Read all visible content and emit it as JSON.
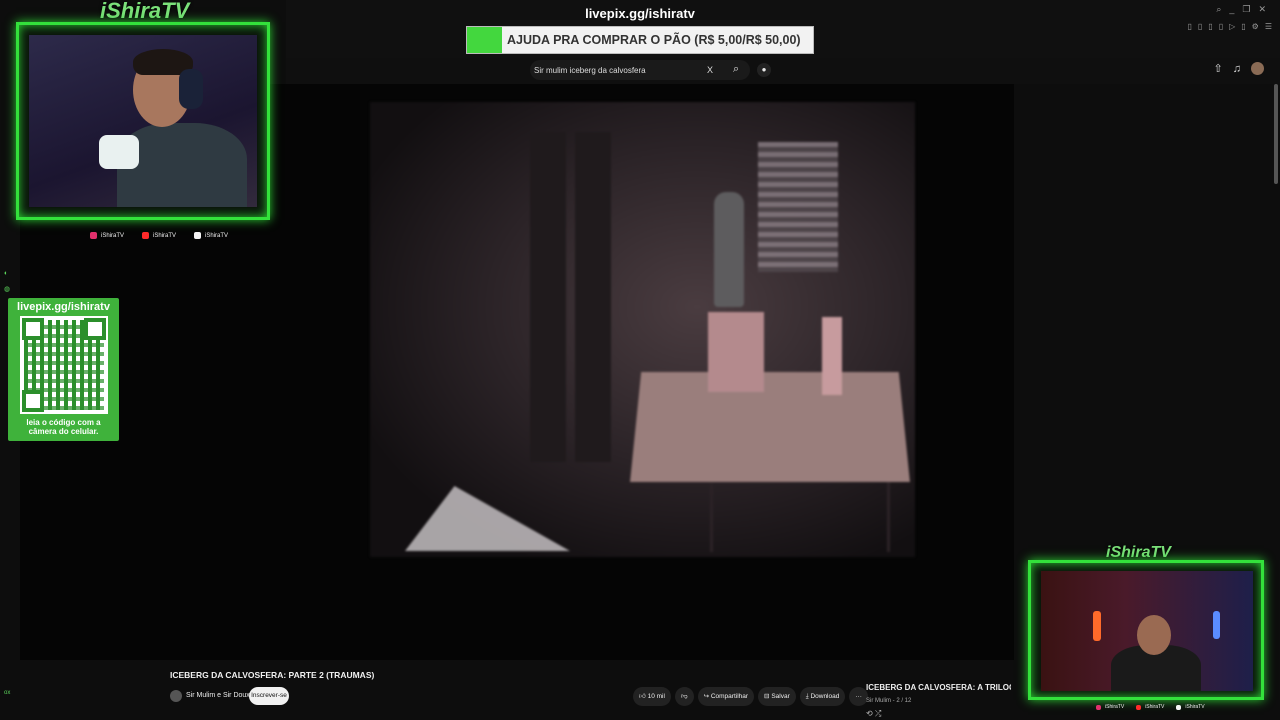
{
  "overlay": {
    "brand": "iShiraTV",
    "livepix_url": "livepix.gg/ishiratv",
    "goal": {
      "text": "AJUDA PRA COMPRAR O PÃO (R$ 5,00/R$ 50,00)",
      "progress": 0.1
    },
    "qr": {
      "url": "livepix.gg/ishiratv",
      "caption_line1": "leia o código com a",
      "caption_line2": "câmera do celular."
    },
    "socials": [
      {
        "label": "iShiraTV",
        "icon": "instagram-icon"
      },
      {
        "label": "iShiraTV",
        "icon": "youtube-icon"
      },
      {
        "label": "iShiraTV",
        "icon": "tiktok-icon"
      }
    ],
    "accent_color": "#33e13b"
  },
  "youtube": {
    "search": {
      "value": "Sir mulim iceberg da calvosfera",
      "clear_label": "X"
    },
    "video": {
      "title": "ICEBERG DA CALVOSFERA: PARTE 2 (TRAUMAS)",
      "channel": "Sir Mulim e Sir Doux",
      "subscribe_label": "Inscrever-se",
      "likes": "10 mil",
      "share_label": "Compartilhar",
      "save_label": "Salvar",
      "download_label": "Download",
      "more_label": "···"
    },
    "playlist": {
      "title": "ICEBERG DA CALVOSFERA: A TRILOGIA (e i",
      "subtitle": "Sir Mulim - 2 / 12"
    }
  },
  "left_rail": {
    "bottom_label": "ox"
  }
}
